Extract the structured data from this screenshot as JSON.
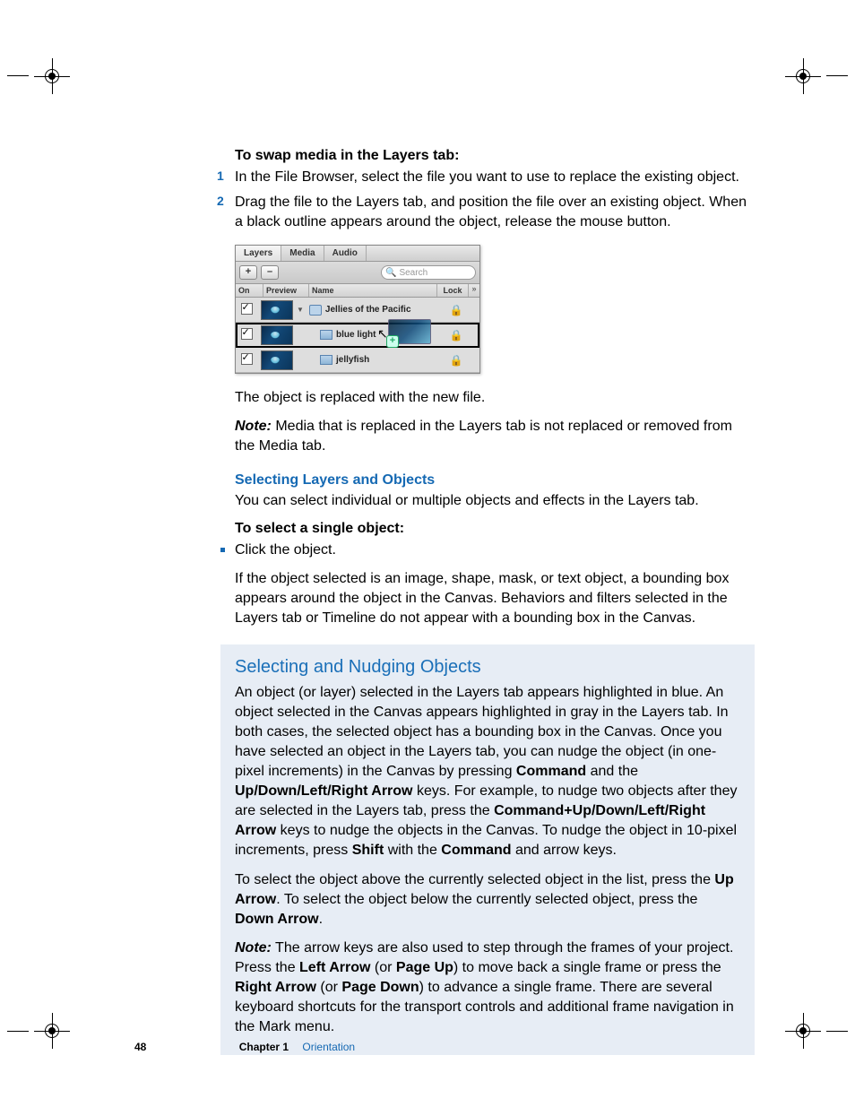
{
  "section1_heading": "To swap media in the Layers tab:",
  "steps": [
    "In the File Browser, select the file you want to use to replace the existing object.",
    "Drag the file to the Layers tab, and position the file over an existing object. When a black outline appears around the object, release the mouse button."
  ],
  "after_panel_p": "The object is replaced with the new file.",
  "note1_label": "Note:",
  "note1_text": "  Media that is replaced in the Layers tab is not replaced or removed from the Media tab.",
  "sub_blue": "Selecting Layers and Objects",
  "sub_blue_p": "You can select individual or multiple objects and effects in the Layers tab.",
  "select_single_h": "To select a single object:",
  "select_single_bullet": "Click the object.",
  "select_single_p": "If the object selected is an image, shape, mask, or text object, a bounding box appears around the object in the Canvas. Behaviors and filters selected in the Layers tab or Timeline do not appear with a bounding box in the Canvas.",
  "callout_title": "Selecting and Nudging Objects",
  "callout_p1_a": "An object (or layer) selected in the Layers tab appears highlighted in blue. An object selected in the Canvas appears highlighted in gray in the Layers tab. In both cases, the selected object has a bounding box in the Canvas. Once you have selected an object in the Layers tab, you can nudge the object (in one-pixel increments) in the Canvas by pressing ",
  "kw_command": "Command",
  "callout_p1_b": " and the ",
  "kw_arrows": "Up/Down/Left/Right Arrow",
  "callout_p1_c": " keys. For example, to nudge two objects after they are selected in the Layers tab, press the ",
  "kw_combo": "Command+Up/Down/Left/Right Arrow",
  "callout_p1_d": " keys to nudge the objects in the Canvas. To nudge the object in 10-pixel increments, press ",
  "kw_shift": "Shift",
  "callout_p1_e": " with the ",
  "kw_command2": "Command",
  "callout_p1_f": " and arrow keys.",
  "callout_p2_a": "To select the object above the currently selected object in the list, press the ",
  "kw_up": "Up Arrow",
  "callout_p2_b": ". To select the object below the currently selected object, press the ",
  "kw_down": "Down Arrow",
  "callout_p2_c": ".",
  "callout_note_label": "Note:",
  "callout_p3_a": "  The arrow keys are also used to step through the frames of your project. Press the ",
  "kw_left": "Left Arrow",
  "callout_p3_b": " (or ",
  "kw_pgup": "Page Up",
  "callout_p3_c": ") to move back a single frame or press the ",
  "kw_right": "Right Arrow",
  "callout_p3_d": " (or ",
  "kw_pgdn": "Page Down",
  "callout_p3_e": ") to advance a single frame. There are several keyboard shortcuts for the transport controls and additional frame navigation in the Mark menu.",
  "footer": {
    "page": "48",
    "chapter": "Chapter 1",
    "name": "Orientation"
  },
  "panel": {
    "tabs": [
      "Layers",
      "Media",
      "Audio"
    ],
    "add_label": "+",
    "remove_label": "–",
    "search_placeholder": "Search",
    "header": {
      "on": "On",
      "preview": "Preview",
      "name": "Name",
      "lock": "Lock",
      "more": "»"
    },
    "rows": [
      {
        "name": "Jellies of the Pacific",
        "type": "group"
      },
      {
        "name": "blue light",
        "type": "item"
      },
      {
        "name": "jellyfish",
        "type": "item"
      }
    ]
  }
}
